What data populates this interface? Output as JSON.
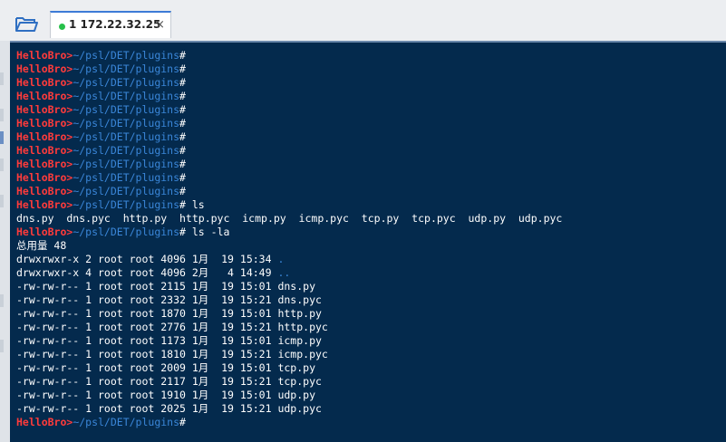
{
  "tab": {
    "title": "1 172.22.32.25",
    "close": "×",
    "status_color": "#27c04a"
  },
  "prompt": {
    "host": "HelloBro>",
    "path": "~/psl/DET/plugins",
    "symbol": "#"
  },
  "terminal": {
    "lines": [
      {
        "type": "prompt",
        "cmd": ""
      },
      {
        "type": "prompt",
        "cmd": ""
      },
      {
        "type": "prompt",
        "cmd": ""
      },
      {
        "type": "prompt",
        "cmd": ""
      },
      {
        "type": "prompt",
        "cmd": ""
      },
      {
        "type": "prompt",
        "cmd": ""
      },
      {
        "type": "prompt",
        "cmd": ""
      },
      {
        "type": "prompt",
        "cmd": ""
      },
      {
        "type": "prompt",
        "cmd": ""
      },
      {
        "type": "prompt",
        "cmd": ""
      },
      {
        "type": "prompt",
        "cmd": ""
      },
      {
        "type": "prompt",
        "cmd": " ls"
      },
      {
        "type": "text",
        "text": "dns.py  dns.pyc  http.py  http.pyc  icmp.py  icmp.pyc  tcp.py  tcp.pyc  udp.py  udp.pyc"
      },
      {
        "type": "prompt",
        "cmd": " ls -la"
      },
      {
        "type": "text",
        "text": "总用量 48"
      },
      {
        "type": "entry",
        "meta": "drwxrwxr-x 2 root root 4096 1月  19 15:34 ",
        "name": ".",
        "dir": true
      },
      {
        "type": "entry",
        "meta": "drwxrwxr-x 4 root root 4096 2月   4 14:49 ",
        "name": "..",
        "dir": true
      },
      {
        "type": "entry",
        "meta": "-rw-rw-r-- 1 root root 2115 1月  19 15:01 ",
        "name": "dns.py",
        "dir": false
      },
      {
        "type": "entry",
        "meta": "-rw-rw-r-- 1 root root 2332 1月  19 15:21 ",
        "name": "dns.pyc",
        "dir": false
      },
      {
        "type": "entry",
        "meta": "-rw-rw-r-- 1 root root 1870 1月  19 15:01 ",
        "name": "http.py",
        "dir": false
      },
      {
        "type": "entry",
        "meta": "-rw-rw-r-- 1 root root 2776 1月  19 15:21 ",
        "name": "http.pyc",
        "dir": false
      },
      {
        "type": "entry",
        "meta": "-rw-rw-r-- 1 root root 1173 1月  19 15:01 ",
        "name": "icmp.py",
        "dir": false
      },
      {
        "type": "entry",
        "meta": "-rw-rw-r-- 1 root root 1810 1月  19 15:21 ",
        "name": "icmp.pyc",
        "dir": false
      },
      {
        "type": "entry",
        "meta": "-rw-rw-r-- 1 root root 2009 1月  19 15:01 ",
        "name": "tcp.py",
        "dir": false
      },
      {
        "type": "entry",
        "meta": "-rw-rw-r-- 1 root root 2117 1月  19 15:21 ",
        "name": "tcp.pyc",
        "dir": false
      },
      {
        "type": "entry",
        "meta": "-rw-rw-r-- 1 root root 1910 1月  19 15:01 ",
        "name": "udp.py",
        "dir": false
      },
      {
        "type": "entry",
        "meta": "-rw-rw-r-- 1 root root 2025 1月  19 15:21 ",
        "name": "udp.pyc",
        "dir": false
      },
      {
        "type": "prompt",
        "cmd": ""
      }
    ]
  },
  "icons": {
    "open_folder": "folder-open-icon",
    "status": "connected-dot-icon",
    "close": "close-icon"
  }
}
